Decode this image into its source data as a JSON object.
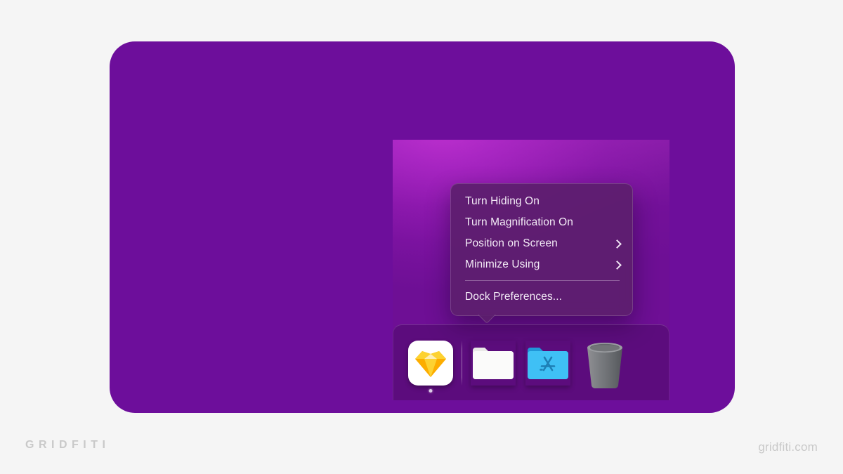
{
  "canvas": {
    "background_color": "#f5f5f5",
    "card_color": "#6d0e9b"
  },
  "screenshot": {
    "wallpaper_colors": [
      "#b529c9",
      "#8b18ac",
      "#660d8d"
    ]
  },
  "context_menu": {
    "items": [
      {
        "label": "Turn Hiding On",
        "has_submenu": false
      },
      {
        "label": "Turn Magnification On",
        "has_submenu": false
      },
      {
        "label": "Position on Screen",
        "has_submenu": true,
        "submenu_icon": "chevron-right-icon"
      },
      {
        "label": "Minimize Using",
        "has_submenu": true,
        "submenu_icon": "chevron-right-icon"
      }
    ],
    "separator": true,
    "footer_items": [
      {
        "label": "Dock Preferences...",
        "has_submenu": false
      }
    ],
    "background_color": "#5c1e6e",
    "text_color": "#f4ecf7"
  },
  "dock": {
    "items": [
      {
        "name": "Sketch",
        "icon": "sketch-icon",
        "running": true
      },
      {
        "name": "Folder",
        "icon": "folder-icon",
        "running": false
      },
      {
        "name": "App Store Folder",
        "icon": "app-store-folder-icon",
        "running": false
      },
      {
        "name": "Trash",
        "icon": "trash-icon",
        "running": false
      }
    ],
    "has_separator": true
  },
  "footer": {
    "brand": "GRIDFITI",
    "url": "gridfiti.com",
    "text_color": "#c9c9c9"
  }
}
